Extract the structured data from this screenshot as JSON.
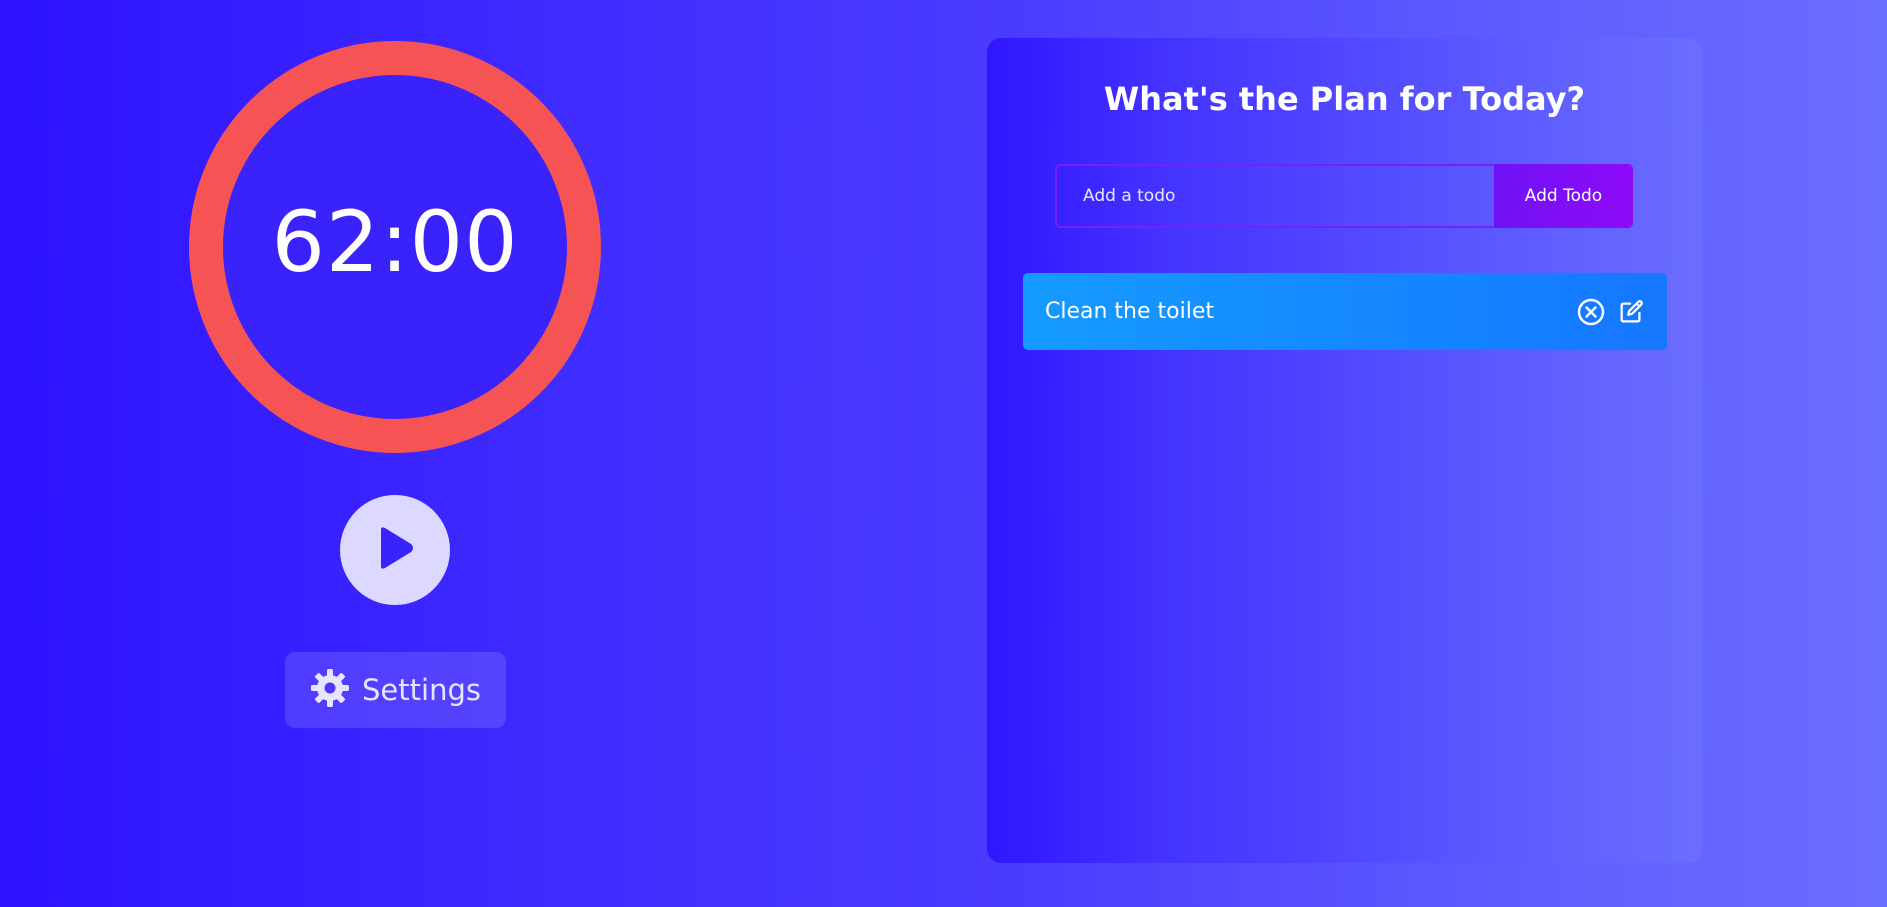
{
  "timer": {
    "display": "62:00",
    "ring_color": "#f65355"
  },
  "controls": {
    "play_icon": "play-icon",
    "settings_icon": "gear-icon",
    "settings_label": "Settings"
  },
  "todo": {
    "title": "What's the Plan for Today?",
    "input_placeholder": "Add a todo",
    "input_value": "",
    "add_button_label": "Add Todo",
    "items": [
      {
        "text": "Clean the toilet",
        "delete_icon": "close-circle-icon",
        "edit_icon": "edit-icon"
      }
    ]
  },
  "colors": {
    "background_start": "#2e12ff",
    "background_end": "#6b6eff",
    "accent_purple": "#8f0af8",
    "todo_item_blue": "#1577ff"
  }
}
